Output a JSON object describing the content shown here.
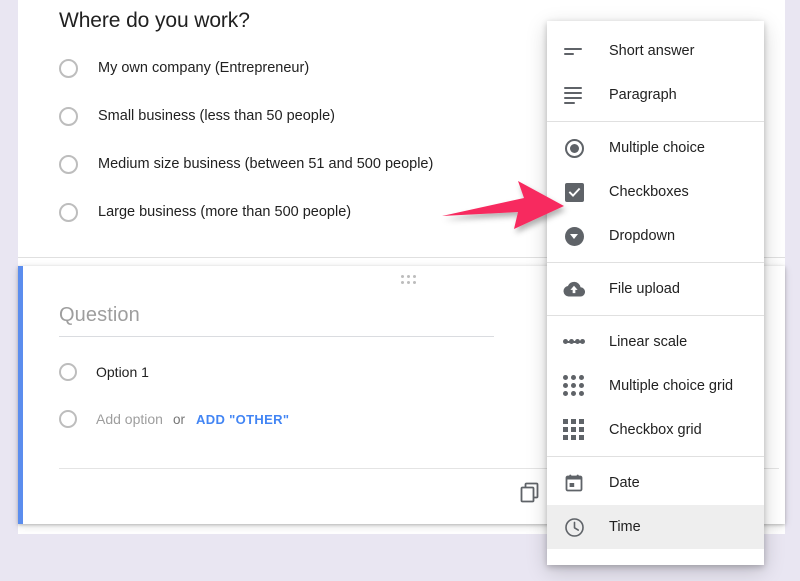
{
  "colors": {
    "page_background": "#E9E6F2",
    "card_background": "#FFFFFF",
    "active_card_accent": "#5B8DEE",
    "link_blue": "#4285F4",
    "icon_gray": "#5F6368",
    "annotation_pink": "#F72A5E",
    "highlight_row": "#EEEEEE"
  },
  "question_card": {
    "title": "Where do you work?",
    "options": [
      {
        "icon": "radio-unchecked-icon",
        "label": "My own company (Entrepreneur)"
      },
      {
        "icon": "radio-unchecked-icon",
        "label": "Small business (less than 50 people)"
      },
      {
        "icon": "radio-unchecked-icon",
        "label": "Medium size business (between 51 and 500 people)"
      },
      {
        "icon": "radio-unchecked-icon",
        "label": "Large business (more than 500 people)"
      }
    ]
  },
  "active_question_card": {
    "drag_handle_icon": "drag-handle-icon",
    "question_input": {
      "value": "",
      "placeholder": "Question"
    },
    "options": [
      {
        "icon": "radio-unchecked-icon",
        "label": "Option 1"
      }
    ],
    "add_option": {
      "icon": "radio-unchecked-icon",
      "label": "Add option",
      "or_label": "or",
      "add_other_label": "ADD \"OTHER\""
    },
    "duplicate_icon": "duplicate-icon"
  },
  "type_menu": {
    "groups": [
      {
        "items": [
          {
            "icon": "short-answer-icon",
            "label": "Short answer",
            "highlighted": false
          },
          {
            "icon": "paragraph-icon",
            "label": "Paragraph",
            "highlighted": false
          }
        ]
      },
      {
        "items": [
          {
            "icon": "multiple-choice-icon",
            "label": "Multiple choice",
            "highlighted": false
          },
          {
            "icon": "checkboxes-icon",
            "label": "Checkboxes",
            "highlighted": false
          },
          {
            "icon": "dropdown-icon",
            "label": "Dropdown",
            "highlighted": false
          }
        ]
      },
      {
        "items": [
          {
            "icon": "file-upload-icon",
            "label": "File upload",
            "highlighted": false
          }
        ]
      },
      {
        "items": [
          {
            "icon": "linear-scale-icon",
            "label": "Linear scale",
            "highlighted": false
          },
          {
            "icon": "multiple-choice-grid-icon",
            "label": "Multiple choice grid",
            "highlighted": false
          },
          {
            "icon": "checkbox-grid-icon",
            "label": "Checkbox grid",
            "highlighted": false
          }
        ]
      },
      {
        "items": [
          {
            "icon": "date-icon",
            "label": "Date",
            "highlighted": false
          },
          {
            "icon": "time-icon",
            "label": "Time",
            "highlighted": true
          }
        ]
      }
    ]
  },
  "annotation": {
    "arrow_icon": "arrow-right-annotation-icon",
    "points_at": "Checkboxes"
  }
}
